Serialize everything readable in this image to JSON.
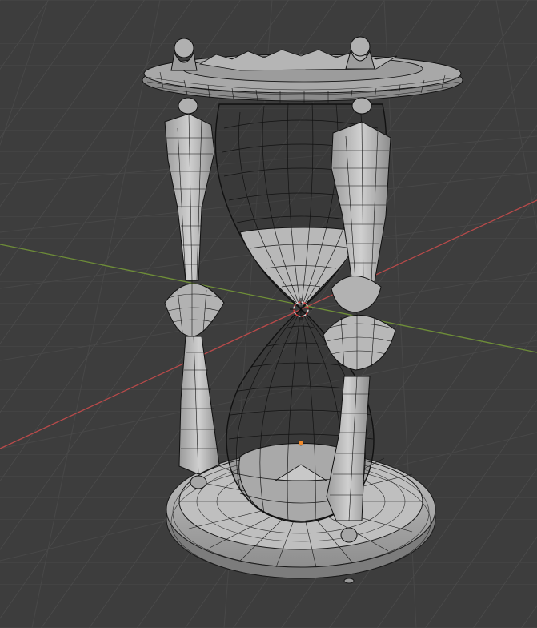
{
  "viewport": {
    "background": "#3d3d3d",
    "grid_color": "#4a4a4a",
    "x_axis_color": "#c0504f",
    "y_axis_color": "#7a9c3c",
    "origin_marker_color": "#f08a2c",
    "cursor_color": "#d23c3c",
    "object_fill": "#b4b4b4",
    "object_shadow": "#8a8a8a",
    "wire_color": "#1a1a1a"
  },
  "scene": {
    "object": "hourglass-mesh",
    "shading": "wireframe-overlay"
  }
}
